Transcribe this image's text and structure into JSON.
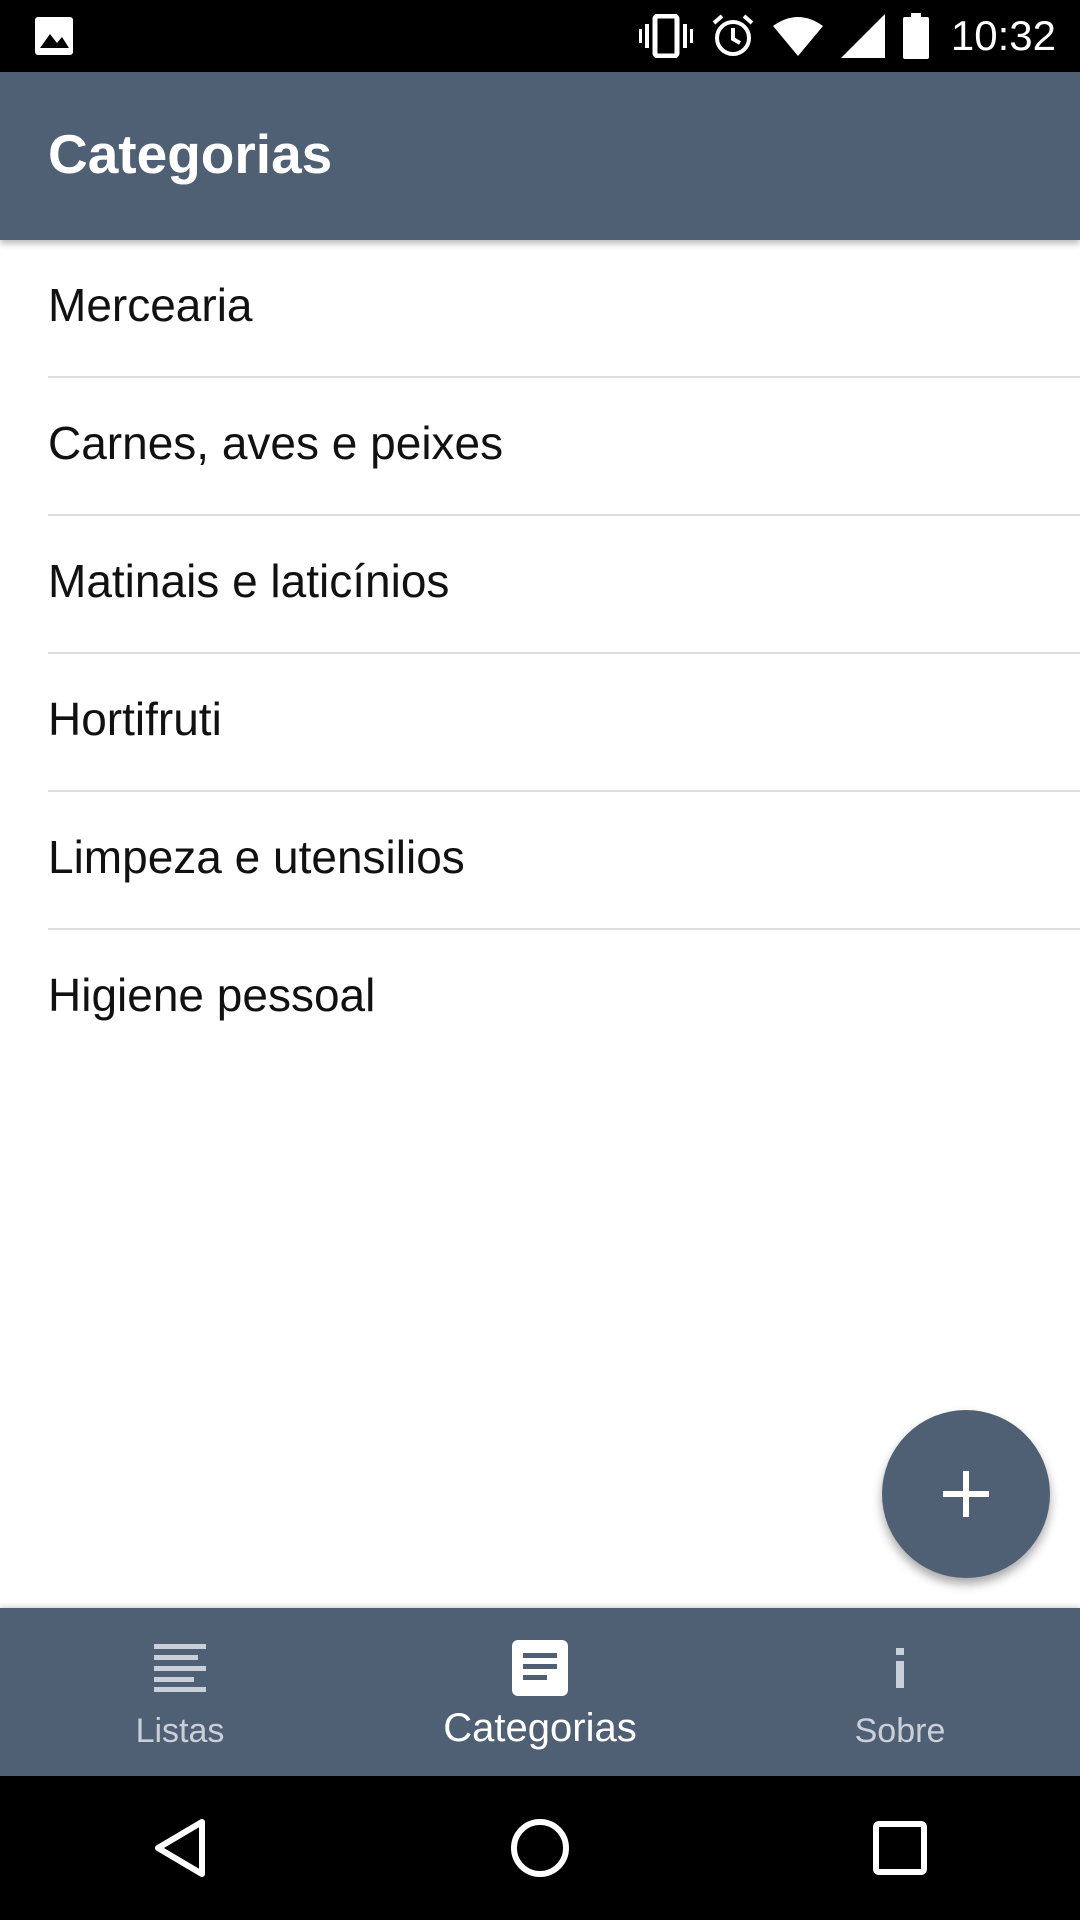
{
  "status_bar": {
    "time": "10:32",
    "icons": [
      "image-icon",
      "vibrate-icon",
      "alarm-icon",
      "wifi-icon",
      "signal-icon",
      "battery-icon"
    ]
  },
  "app_bar": {
    "title": "Categorias",
    "color": "#506074"
  },
  "categories": [
    {
      "label": "Mercearia"
    },
    {
      "label": "Carnes, aves e peixes"
    },
    {
      "label": "Matinais e laticínios"
    },
    {
      "label": "Hortifruti"
    },
    {
      "label": "Limpeza e utensilios"
    },
    {
      "label": "Higiene pessoal"
    }
  ],
  "fab": {
    "icon": "plus-icon"
  },
  "bottom_nav": {
    "items": [
      {
        "label": "Listas",
        "icon": "list-lines-icon",
        "active": false
      },
      {
        "label": "Categorias",
        "icon": "document-icon",
        "active": true
      },
      {
        "label": "Sobre",
        "icon": "info-icon",
        "active": false
      }
    ]
  },
  "system_nav": {
    "icons": [
      "back-icon",
      "home-icon",
      "recents-icon"
    ]
  }
}
